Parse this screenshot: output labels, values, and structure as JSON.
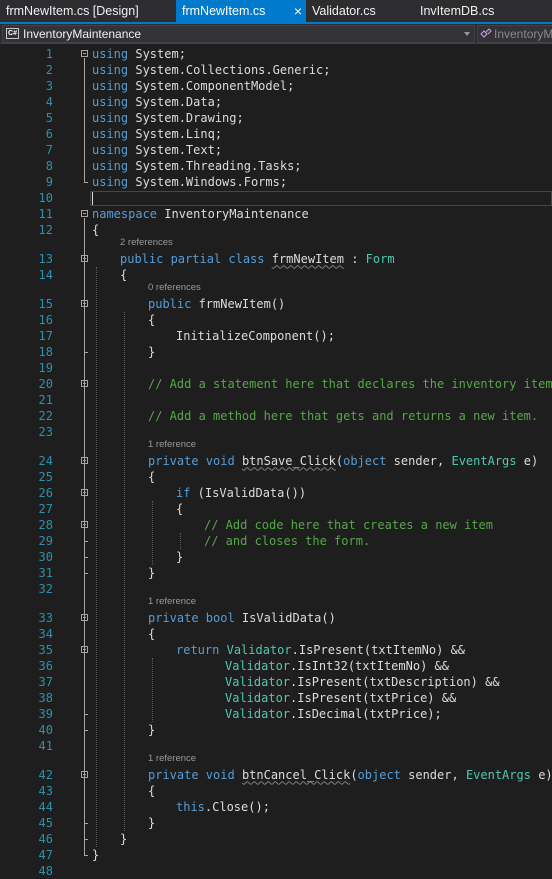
{
  "tabs": [
    {
      "label": "frmNewItem.cs [Design]",
      "active": false
    },
    {
      "label": "frmNewItem.cs",
      "active": true,
      "close": "×"
    },
    {
      "label": "Validator.cs",
      "active": false
    },
    {
      "label": "InvItemDB.cs",
      "active": false
    }
  ],
  "nav": {
    "project_icon": "C#",
    "project": "InventoryMaintenance",
    "member": "InventoryMaintenance.frmNewItem"
  },
  "code_lens": {
    "l13": "2 references",
    "l15": "0 references",
    "l24": "1 reference",
    "l33": "1 reference",
    "l42": "1 reference"
  },
  "line_numbers": [
    "1",
    "2",
    "3",
    "4",
    "5",
    "6",
    "7",
    "8",
    "9",
    "10",
    "11",
    "12",
    "13",
    "14",
    "15",
    "16",
    "17",
    "18",
    "19",
    "20",
    "21",
    "22",
    "23",
    "24",
    "25",
    "26",
    "27",
    "28",
    "29",
    "30",
    "31",
    "32",
    "33",
    "34",
    "35",
    "36",
    "37",
    "38",
    "39",
    "40",
    "41",
    "42",
    "43",
    "44",
    "45",
    "46",
    "47",
    "48"
  ],
  "code": {
    "l1": [
      {
        "t": "using",
        "c": "kw"
      },
      {
        "t": " System;"
      }
    ],
    "l2": [
      {
        "t": "using",
        "c": "kw"
      },
      {
        "t": " System.Collections.Generic;"
      }
    ],
    "l3": [
      {
        "t": "using",
        "c": "kw"
      },
      {
        "t": " System.ComponentModel;"
      }
    ],
    "l4": [
      {
        "t": "using",
        "c": "kw"
      },
      {
        "t": " System.Data;"
      }
    ],
    "l5": [
      {
        "t": "using",
        "c": "kw"
      },
      {
        "t": " System.Drawing;"
      }
    ],
    "l6": [
      {
        "t": "using",
        "c": "kw"
      },
      {
        "t": " System.Linq;"
      }
    ],
    "l7": [
      {
        "t": "using",
        "c": "kw"
      },
      {
        "t": " System.Text;"
      }
    ],
    "l8": [
      {
        "t": "using",
        "c": "kw"
      },
      {
        "t": " System.Threading.Tasks;"
      }
    ],
    "l9": [
      {
        "t": "using",
        "c": "kw"
      },
      {
        "t": " System.Windows.Forms;"
      }
    ],
    "l10": [],
    "l11": [
      {
        "t": "namespace",
        "c": "kw"
      },
      {
        "t": " InventoryMaintenance"
      }
    ],
    "l12": [
      {
        "t": "{"
      }
    ],
    "l13": [
      {
        "t": "public partial class",
        "c": "kw"
      },
      {
        "t": " "
      },
      {
        "t": "frmNewItem",
        "s": true
      },
      {
        "t": " : "
      },
      {
        "t": "Form",
        "c": "ty"
      }
    ],
    "l14": [
      {
        "t": "{"
      }
    ],
    "l15": [
      {
        "t": "public",
        "c": "kw"
      },
      {
        "t": " frmNewItem()"
      }
    ],
    "l16": [
      {
        "t": "{"
      }
    ],
    "l17": [
      {
        "t": "InitializeComponent();"
      }
    ],
    "l18": [
      {
        "t": "}"
      }
    ],
    "l19": [],
    "l20": [
      {
        "t": "// Add a statement here that declares the inventory item.",
        "c": "cm"
      }
    ],
    "l21": [],
    "l22": [
      {
        "t": "// Add a method here that gets and returns a new item.",
        "c": "cm"
      }
    ],
    "l23": [],
    "l24": [
      {
        "t": "private void",
        "c": "kw"
      },
      {
        "t": " "
      },
      {
        "t": "btnSave_Click",
        "s": true
      },
      {
        "t": "("
      },
      {
        "t": "object",
        "c": "kw"
      },
      {
        "t": " sender, "
      },
      {
        "t": "EventArgs",
        "c": "ty"
      },
      {
        "t": " e)"
      }
    ],
    "l25": [
      {
        "t": "{"
      }
    ],
    "l26": [
      {
        "t": "if",
        "c": "kw"
      },
      {
        "t": " (IsValidData())"
      }
    ],
    "l27": [
      {
        "t": "{"
      }
    ],
    "l28": [
      {
        "t": "// Add code here that creates a new item",
        "c": "cm"
      }
    ],
    "l29": [
      {
        "t": "// and closes the form.",
        "c": "cm"
      }
    ],
    "l30": [
      {
        "t": "}"
      }
    ],
    "l31": [
      {
        "t": "}"
      }
    ],
    "l32": [],
    "l33": [
      {
        "t": "private bool",
        "c": "kw"
      },
      {
        "t": " IsValidData()"
      }
    ],
    "l34": [
      {
        "t": "{"
      }
    ],
    "l35": [
      {
        "t": "return",
        "c": "kw"
      },
      {
        "t": " "
      },
      {
        "t": "Validator",
        "c": "ty"
      },
      {
        "t": ".IsPresent(txtItemNo) &&"
      }
    ],
    "l36": [
      {
        "t": "Validator",
        "c": "ty"
      },
      {
        "t": ".IsInt32(txtItemNo) &&"
      }
    ],
    "l37": [
      {
        "t": "Validator",
        "c": "ty"
      },
      {
        "t": ".IsPresent(txtDescription) &&"
      }
    ],
    "l38": [
      {
        "t": "Validator",
        "c": "ty"
      },
      {
        "t": ".IsPresent(txtPrice) &&"
      }
    ],
    "l39": [
      {
        "t": "Validator",
        "c": "ty"
      },
      {
        "t": ".IsDecimal(txtPrice);"
      }
    ],
    "l40": [
      {
        "t": "}"
      }
    ],
    "l41": [],
    "l42": [
      {
        "t": "private void",
        "c": "kw"
      },
      {
        "t": " "
      },
      {
        "t": "btnCancel_Click",
        "s": true
      },
      {
        "t": "("
      },
      {
        "t": "object",
        "c": "kw"
      },
      {
        "t": " sender, "
      },
      {
        "t": "EventArgs",
        "c": "ty"
      },
      {
        "t": " e)"
      }
    ],
    "l43": [
      {
        "t": "{"
      }
    ],
    "l44": [
      {
        "t": "this",
        "c": "kw"
      },
      {
        "t": ".Close();"
      }
    ],
    "l45": [
      {
        "t": "}"
      }
    ],
    "l46": [
      {
        "t": "}"
      }
    ],
    "l47": [
      {
        "t": "}"
      }
    ],
    "l48": []
  },
  "colors": {
    "background": "#1e1e1e",
    "keyword": "#569cd6",
    "type": "#4ec9b0",
    "comment": "#57a64a",
    "text": "#dcdcdc",
    "line_number": "#2b91af",
    "accent": "#007acc"
  }
}
